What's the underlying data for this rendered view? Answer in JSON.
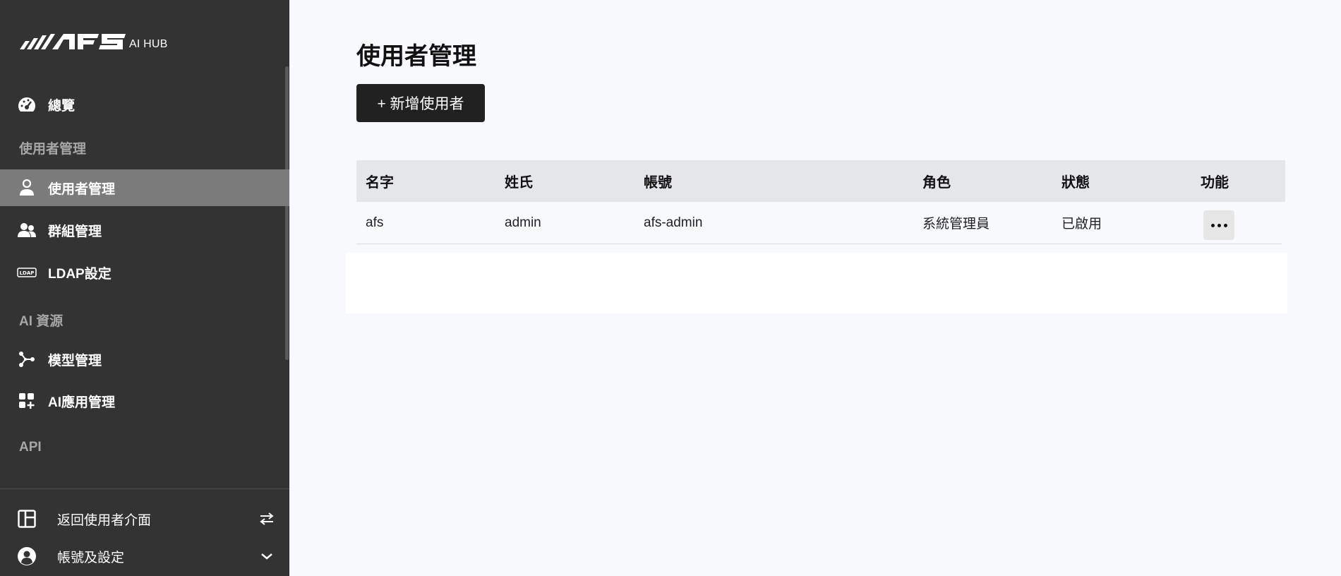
{
  "brand": {
    "logo_text": "AFS",
    "sub": "AI HUB"
  },
  "sidebar": {
    "overview": "總覽",
    "section_user": "使用者管理",
    "user_mgmt": "使用者管理",
    "group_mgmt": "群組管理",
    "ldap": "LDAP設定",
    "section_ai": "AI 資源",
    "model_mgmt": "模型管理",
    "app_mgmt": "AI應用管理",
    "section_api": "API",
    "back_to_user": "返回使用者介面",
    "account_settings": "帳號及設定"
  },
  "main": {
    "title": "使用者管理",
    "add_button": "+ 新增使用者",
    "table": {
      "headers": [
        "名字",
        "姓氏",
        "帳號",
        "角色",
        "狀態",
        "功能"
      ],
      "rows": [
        [
          "afs",
          "admin",
          "afs-admin",
          "系統管理員",
          "已啟用"
        ]
      ]
    }
  },
  "colors": {
    "sidebar_bg": "#333333",
    "sidebar_active": "#7b7b7b",
    "main_bg": "#f8f9fc",
    "button_bg": "#212121",
    "table_header_bg": "#e5e6ea"
  }
}
